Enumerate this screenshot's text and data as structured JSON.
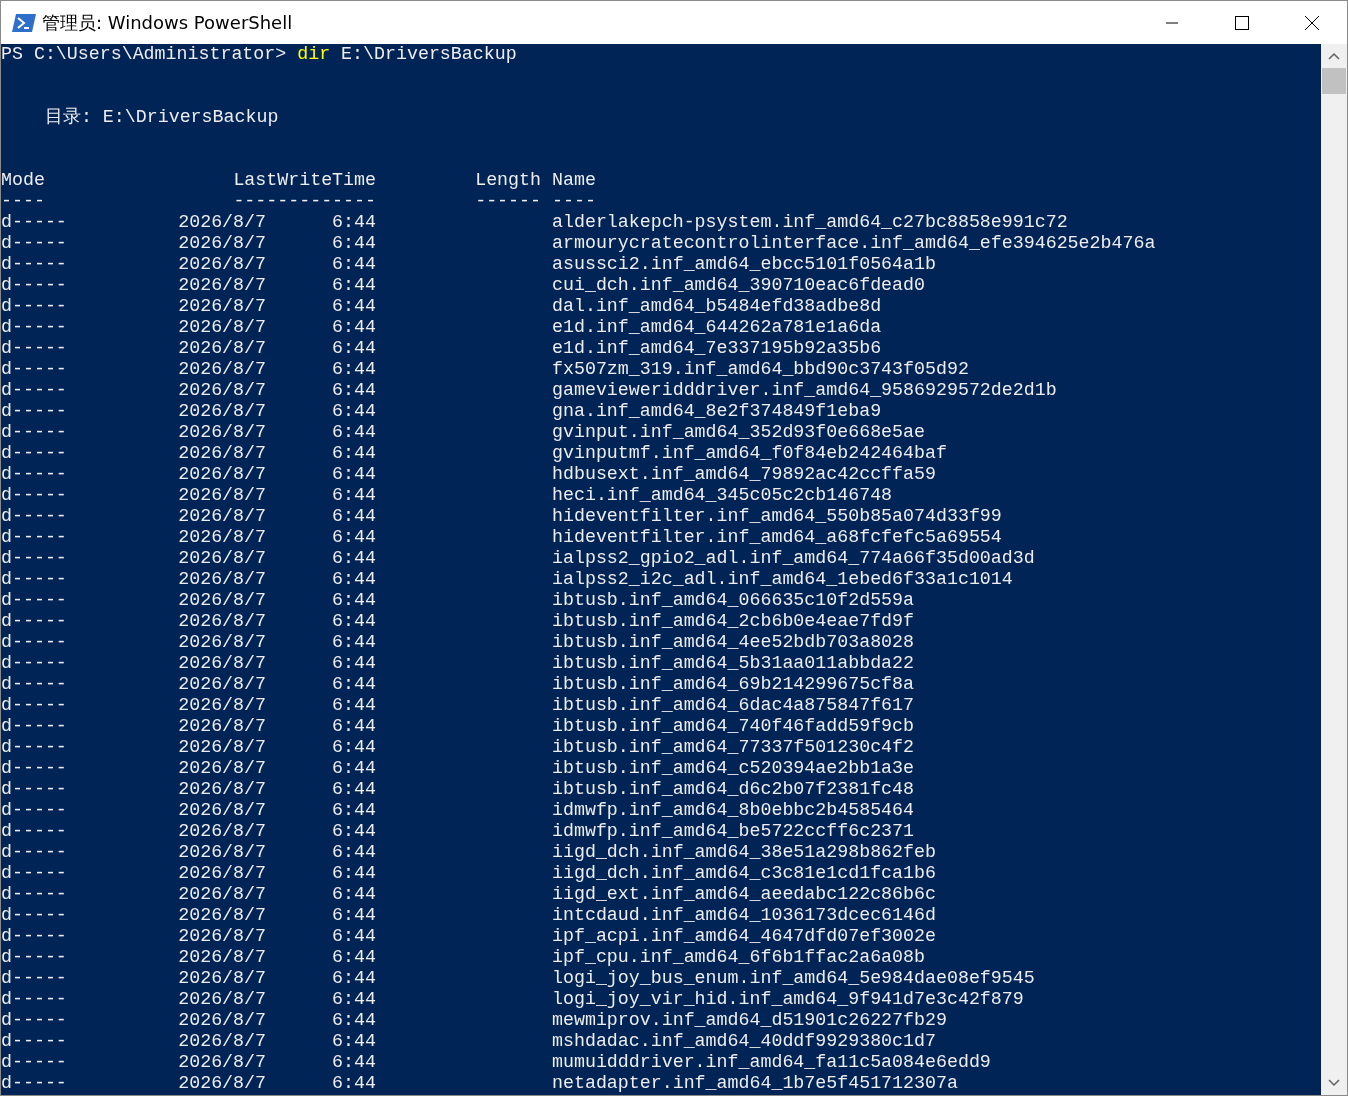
{
  "window": {
    "title": "管理员: Windows PowerShell"
  },
  "prompt": {
    "path": "PS C:\\Users\\Administrator>",
    "command": "dir",
    "argument": "E:\\DriversBackup"
  },
  "directory": {
    "label": "目录:",
    "path": "E:\\DriversBackup"
  },
  "columns": [
    {
      "label": "Mode",
      "underline": "----"
    },
    {
      "label": "LastWriteTime",
      "underline": "-------------"
    },
    {
      "label": "Length",
      "underline": "------"
    },
    {
      "label": "Name",
      "underline": "----"
    }
  ],
  "rows": [
    {
      "mode": "d-----",
      "date": "2026/8/7",
      "time": "6:44",
      "name": "alderlakepch-psystem.inf_amd64_c27bc8858e991c72"
    },
    {
      "mode": "d-----",
      "date": "2026/8/7",
      "time": "6:44",
      "name": "armourycratecontrolinterface.inf_amd64_efe394625e2b476a"
    },
    {
      "mode": "d-----",
      "date": "2026/8/7",
      "time": "6:44",
      "name": "asussci2.inf_amd64_ebcc5101f0564a1b"
    },
    {
      "mode": "d-----",
      "date": "2026/8/7",
      "time": "6:44",
      "name": "cui_dch.inf_amd64_390710eac6fdead0"
    },
    {
      "mode": "d-----",
      "date": "2026/8/7",
      "time": "6:44",
      "name": "dal.inf_amd64_b5484efd38adbe8d"
    },
    {
      "mode": "d-----",
      "date": "2026/8/7",
      "time": "6:44",
      "name": "e1d.inf_amd64_644262a781e1a6da"
    },
    {
      "mode": "d-----",
      "date": "2026/8/7",
      "time": "6:44",
      "name": "e1d.inf_amd64_7e337195b92a35b6"
    },
    {
      "mode": "d-----",
      "date": "2026/8/7",
      "time": "6:44",
      "name": "fx507zm_319.inf_amd64_bbd90c3743f05d92"
    },
    {
      "mode": "d-----",
      "date": "2026/8/7",
      "time": "6:44",
      "name": "gamevieweridddriver.inf_amd64_9586929572de2d1b"
    },
    {
      "mode": "d-----",
      "date": "2026/8/7",
      "time": "6:44",
      "name": "gna.inf_amd64_8e2f374849f1eba9"
    },
    {
      "mode": "d-----",
      "date": "2026/8/7",
      "time": "6:44",
      "name": "gvinput.inf_amd64_352d93f0e668e5ae"
    },
    {
      "mode": "d-----",
      "date": "2026/8/7",
      "time": "6:44",
      "name": "gvinputmf.inf_amd64_f0f84eb242464baf"
    },
    {
      "mode": "d-----",
      "date": "2026/8/7",
      "time": "6:44",
      "name": "hdbusext.inf_amd64_79892ac42ccffa59"
    },
    {
      "mode": "d-----",
      "date": "2026/8/7",
      "time": "6:44",
      "name": "heci.inf_amd64_345c05c2cb146748"
    },
    {
      "mode": "d-----",
      "date": "2026/8/7",
      "time": "6:44",
      "name": "hideventfilter.inf_amd64_550b85a074d33f99"
    },
    {
      "mode": "d-----",
      "date": "2026/8/7",
      "time": "6:44",
      "name": "hideventfilter.inf_amd64_a68fcfefc5a69554"
    },
    {
      "mode": "d-----",
      "date": "2026/8/7",
      "time": "6:44",
      "name": "ialpss2_gpio2_adl.inf_amd64_774a66f35d00ad3d"
    },
    {
      "mode": "d-----",
      "date": "2026/8/7",
      "time": "6:44",
      "name": "ialpss2_i2c_adl.inf_amd64_1ebed6f33a1c1014"
    },
    {
      "mode": "d-----",
      "date": "2026/8/7",
      "time": "6:44",
      "name": "ibtusb.inf_amd64_066635c10f2d559a"
    },
    {
      "mode": "d-----",
      "date": "2026/8/7",
      "time": "6:44",
      "name": "ibtusb.inf_amd64_2cb6b0e4eae7fd9f"
    },
    {
      "mode": "d-----",
      "date": "2026/8/7",
      "time": "6:44",
      "name": "ibtusb.inf_amd64_4ee52bdb703a8028"
    },
    {
      "mode": "d-----",
      "date": "2026/8/7",
      "time": "6:44",
      "name": "ibtusb.inf_amd64_5b31aa011abbda22"
    },
    {
      "mode": "d-----",
      "date": "2026/8/7",
      "time": "6:44",
      "name": "ibtusb.inf_amd64_69b214299675cf8a"
    },
    {
      "mode": "d-----",
      "date": "2026/8/7",
      "time": "6:44",
      "name": "ibtusb.inf_amd64_6dac4a875847f617"
    },
    {
      "mode": "d-----",
      "date": "2026/8/7",
      "time": "6:44",
      "name": "ibtusb.inf_amd64_740f46fadd59f9cb"
    },
    {
      "mode": "d-----",
      "date": "2026/8/7",
      "time": "6:44",
      "name": "ibtusb.inf_amd64_77337f501230c4f2"
    },
    {
      "mode": "d-----",
      "date": "2026/8/7",
      "time": "6:44",
      "name": "ibtusb.inf_amd64_c520394ae2bb1a3e"
    },
    {
      "mode": "d-----",
      "date": "2026/8/7",
      "time": "6:44",
      "name": "ibtusb.inf_amd64_d6c2b07f2381fc48"
    },
    {
      "mode": "d-----",
      "date": "2026/8/7",
      "time": "6:44",
      "name": "idmwfp.inf_amd64_8b0ebbc2b4585464"
    },
    {
      "mode": "d-----",
      "date": "2026/8/7",
      "time": "6:44",
      "name": "idmwfp.inf_amd64_be5722ccff6c2371"
    },
    {
      "mode": "d-----",
      "date": "2026/8/7",
      "time": "6:44",
      "name": "iigd_dch.inf_amd64_38e51a298b862feb"
    },
    {
      "mode": "d-----",
      "date": "2026/8/7",
      "time": "6:44",
      "name": "iigd_dch.inf_amd64_c3c81e1cd1fca1b6"
    },
    {
      "mode": "d-----",
      "date": "2026/8/7",
      "time": "6:44",
      "name": "iigd_ext.inf_amd64_aeedabc122c86b6c"
    },
    {
      "mode": "d-----",
      "date": "2026/8/7",
      "time": "6:44",
      "name": "intcdaud.inf_amd64_1036173dcec6146d"
    },
    {
      "mode": "d-----",
      "date": "2026/8/7",
      "time": "6:44",
      "name": "ipf_acpi.inf_amd64_4647dfd07ef3002e"
    },
    {
      "mode": "d-----",
      "date": "2026/8/7",
      "time": "6:44",
      "name": "ipf_cpu.inf_amd64_6f6b1ffac2a6a08b"
    },
    {
      "mode": "d-----",
      "date": "2026/8/7",
      "time": "6:44",
      "name": "logi_joy_bus_enum.inf_amd64_5e984dae08ef9545"
    },
    {
      "mode": "d-----",
      "date": "2026/8/7",
      "time": "6:44",
      "name": "logi_joy_vir_hid.inf_amd64_9f941d7e3c42f879"
    },
    {
      "mode": "d-----",
      "date": "2026/8/7",
      "time": "6:44",
      "name": "mewmiprov.inf_amd64_d51901c26227fb29"
    },
    {
      "mode": "d-----",
      "date": "2026/8/7",
      "time": "6:44",
      "name": "mshdadac.inf_amd64_40ddf9929380c1d7"
    },
    {
      "mode": "d-----",
      "date": "2026/8/7",
      "time": "6:44",
      "name": "mumuidddriver.inf_amd64_fa11c5a084e6edd9"
    },
    {
      "mode": "d-----",
      "date": "2026/8/7",
      "time": "6:44",
      "name": "netadapter.inf_amd64_1b7e5f451712307a"
    }
  ]
}
